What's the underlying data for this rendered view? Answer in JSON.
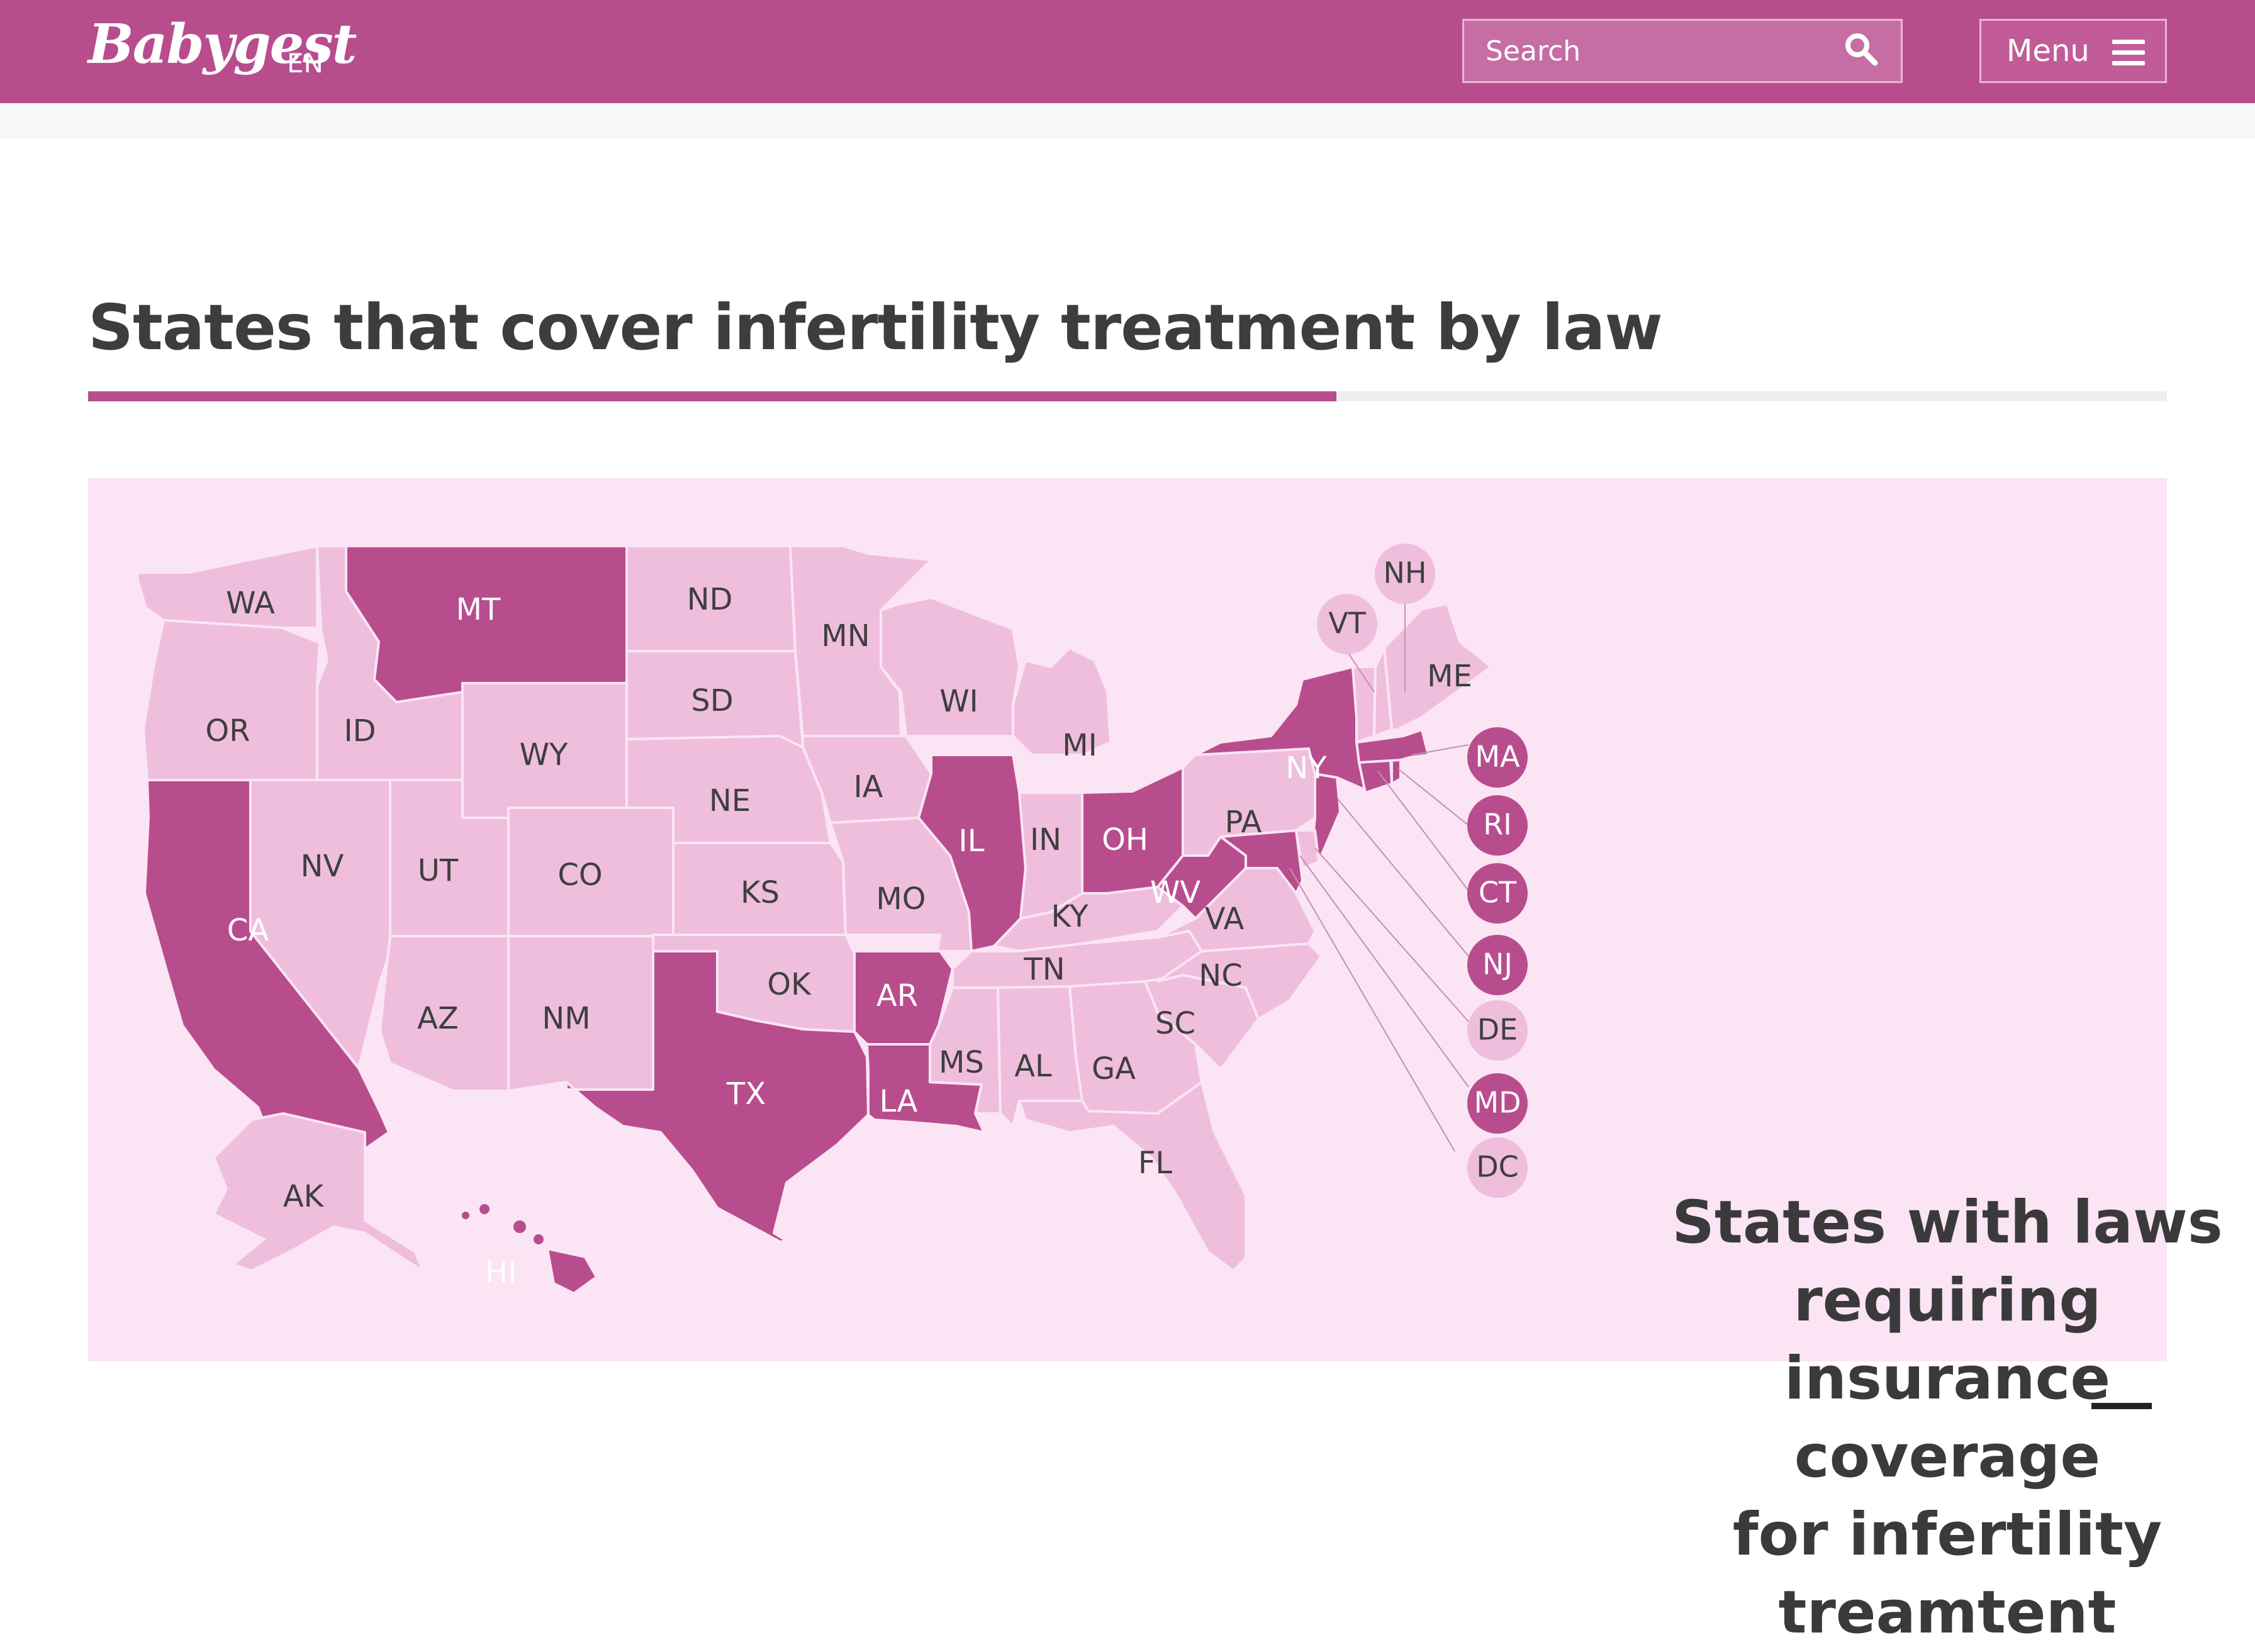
{
  "header": {
    "logo": "Babygest",
    "language": "EN",
    "search_placeholder": "Search",
    "menu_label": "Menu"
  },
  "page_title": "States that cover infertility treatment by law",
  "map": {
    "heading_lines": [
      "States with laws",
      "requiring",
      "insurance",
      "coverage",
      "for infertility",
      "treamtent"
    ],
    "colors": {
      "covered": "#b84d8e",
      "not_covered": "#efbedd",
      "panel_background": "#fbe4f4",
      "border": "#fbe4f4"
    },
    "states": [
      {
        "code": "WA",
        "covered": false
      },
      {
        "code": "OR",
        "covered": false
      },
      {
        "code": "CA",
        "covered": true
      },
      {
        "code": "ID",
        "covered": false
      },
      {
        "code": "NV",
        "covered": false
      },
      {
        "code": "MT",
        "covered": true
      },
      {
        "code": "WY",
        "covered": false
      },
      {
        "code": "UT",
        "covered": false
      },
      {
        "code": "AZ",
        "covered": false
      },
      {
        "code": "CO",
        "covered": false
      },
      {
        "code": "NM",
        "covered": false
      },
      {
        "code": "ND",
        "covered": false
      },
      {
        "code": "SD",
        "covered": false
      },
      {
        "code": "NE",
        "covered": false
      },
      {
        "code": "KS",
        "covered": false
      },
      {
        "code": "OK",
        "covered": false
      },
      {
        "code": "TX",
        "covered": true
      },
      {
        "code": "MN",
        "covered": false
      },
      {
        "code": "IA",
        "covered": false
      },
      {
        "code": "MO",
        "covered": false
      },
      {
        "code": "AR",
        "covered": true
      },
      {
        "code": "LA",
        "covered": true
      },
      {
        "code": "WI",
        "covered": false
      },
      {
        "code": "IL",
        "covered": true
      },
      {
        "code": "MI",
        "covered": false
      },
      {
        "code": "IN",
        "covered": false
      },
      {
        "code": "OH",
        "covered": true
      },
      {
        "code": "KY",
        "covered": false
      },
      {
        "code": "TN",
        "covered": false
      },
      {
        "code": "MS",
        "covered": false
      },
      {
        "code": "AL",
        "covered": false
      },
      {
        "code": "GA",
        "covered": false
      },
      {
        "code": "FL",
        "covered": false
      },
      {
        "code": "SC",
        "covered": false
      },
      {
        "code": "NC",
        "covered": false
      },
      {
        "code": "VA",
        "covered": false
      },
      {
        "code": "WV",
        "covered": true
      },
      {
        "code": "PA",
        "covered": false
      },
      {
        "code": "NY",
        "covered": true
      },
      {
        "code": "VT",
        "covered": false
      },
      {
        "code": "NH",
        "covered": false
      },
      {
        "code": "ME",
        "covered": false
      },
      {
        "code": "AK",
        "covered": false
      },
      {
        "code": "HI",
        "covered": true
      }
    ],
    "small_states": [
      {
        "code": "NH",
        "covered": false
      },
      {
        "code": "VT",
        "covered": false
      },
      {
        "code": "MA",
        "covered": true
      },
      {
        "code": "RI",
        "covered": true
      },
      {
        "code": "CT",
        "covered": true
      },
      {
        "code": "NJ",
        "covered": true
      },
      {
        "code": "DE",
        "covered": false
      },
      {
        "code": "MD",
        "covered": true
      },
      {
        "code": "DC",
        "covered": false
      }
    ]
  }
}
